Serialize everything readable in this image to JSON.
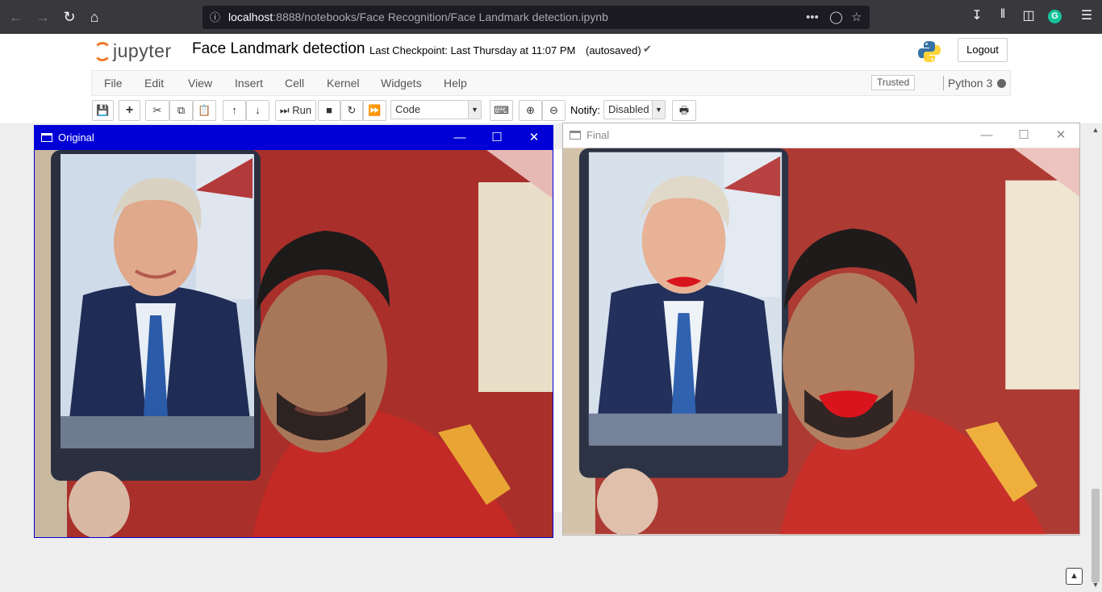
{
  "browser": {
    "url_host": "localhost",
    "url_rest": ":8888/notebooks/Face Recognition/Face Landmark detection.ipynb",
    "more_label": "•••"
  },
  "jupyter": {
    "logo_text": "jupyter",
    "notebook_title": "Face Landmark detection",
    "checkpoint": "Last Checkpoint: Last Thursday at 11:07 PM",
    "autosave": "(autosaved)",
    "logout": "Logout",
    "menu": [
      "File",
      "Edit",
      "View",
      "Insert",
      "Cell",
      "Kernel",
      "Widgets",
      "Help"
    ],
    "trusted": "Trusted",
    "kernel": "Python 3",
    "toolbar": {
      "run_label": "Run",
      "cell_type": "Code",
      "notify_label": "Notify:",
      "notify_value": "Disabled"
    }
  },
  "windows": {
    "original_title": "Original",
    "final_title": "Final"
  },
  "colors": {
    "active_titlebar": "#0000d6",
    "jupyter_orange": "#f37726",
    "lip_red": "#d9141c"
  }
}
